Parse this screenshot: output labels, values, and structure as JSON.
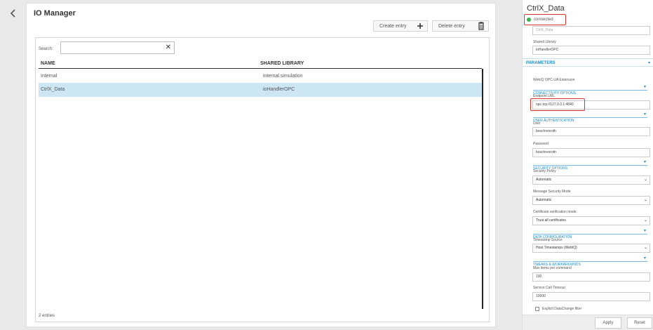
{
  "manager": {
    "title": "IO Manager",
    "create_label": "Create entry",
    "create_icon": "plus-icon",
    "delete_label": "Delete entry",
    "delete_icon": "trash-icon",
    "search_label": "Search:",
    "search_value": "",
    "columns": [
      "NAME",
      "SHARED LIBRARY"
    ],
    "rows": [
      {
        "name": "Internal",
        "library": "internal.simulation",
        "selected": false
      },
      {
        "name": "CtrlX_Data",
        "library": "ioHandlerOPC",
        "selected": true
      }
    ],
    "entry_count": "2 entries"
  },
  "panel": {
    "title": "CtrlX_Data",
    "status": "connected",
    "status_color": "#3cb44b",
    "name_value": "CtrlX_Data",
    "shared_library_label": "Shared Library",
    "shared_library_value": "ioHandlerOPC",
    "parameters_label": "PARAMETERS",
    "extension_label": "WebIQ OPC-UA Extension",
    "connectivity_label": "CONNECTIVITY OPTIONS",
    "endpoint_label": "Endpoint URL",
    "endpoint_value": "opc.tcp://127.0.0.1:4840",
    "user_auth_label": "USER AUTHENTICATION",
    "user_label": "User",
    "user_value": "boschrexroth",
    "password_label": "Password",
    "password_value": "boschrexroth",
    "security_label": "SECURITY OPTIONS",
    "security_policy_label": "Security Policy",
    "security_policy_value": "Automatic",
    "message_mode_label": "Message Security Mode",
    "message_mode_value": "Automatic",
    "cert_label": "Certificate verification mode",
    "cert_value": "Trust all certificates",
    "data_config_label": "DATA CONFIGURATION",
    "timestamp_label": "Timestamp Source",
    "timestamp_value": "Host Timestamps (WebIQ)",
    "tweaks_label": "TWEAKS & WORKAROUNDS",
    "max_items_label": "Max items per command",
    "max_items_value": "100",
    "timeout_label": "Service Call Timeout",
    "timeout_value": "10000",
    "explicit_label": "Explicit DataChange filter",
    "apply_label": "Apply",
    "reset_label": "Reset"
  }
}
